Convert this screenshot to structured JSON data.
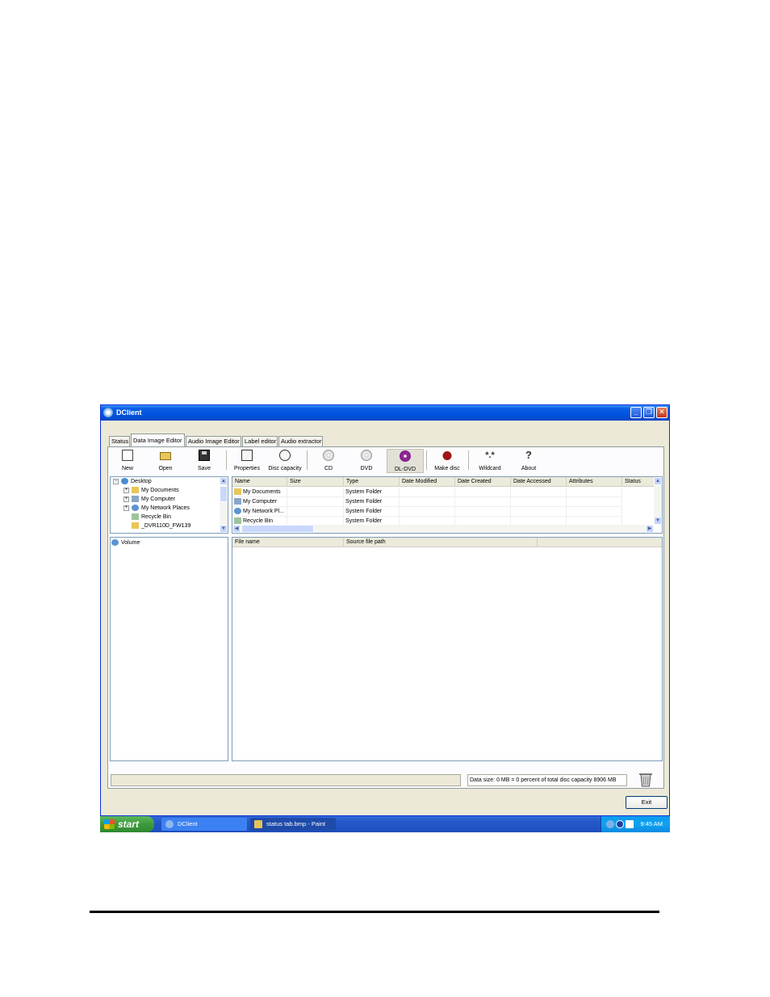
{
  "window": {
    "title": "DClient",
    "buttons": {
      "minimize": "_",
      "restore": "❐",
      "close": "✕"
    }
  },
  "tabs": [
    "Status",
    "Data Image Editor",
    "Audio Image Editor",
    "Label editor",
    "Audio extractor"
  ],
  "toolbar": {
    "new": "New",
    "open": "Open",
    "save": "Save",
    "properties": "Properties",
    "disc_capacity": "Disc capacity",
    "cd": "CD",
    "dvd": "DVD",
    "dl_dvd": "DL-DVD",
    "make_disc": "Make disc",
    "wildcard": "Wildcard",
    "wildcard_glyph": "*.*",
    "about": "About",
    "about_glyph": "?"
  },
  "tree": {
    "root": "Desktop",
    "items": [
      "My Documents",
      "My Computer",
      "My Network Places",
      "Recycle Bin",
      "_DVR110D_FW139"
    ]
  },
  "file_list": {
    "columns": [
      "Name",
      "Size",
      "Type",
      "Date Modified",
      "Date Created",
      "Date Accessed",
      "Attributes",
      "Status"
    ],
    "rows": [
      {
        "name": "My Documents",
        "size": "",
        "type": "System Folder"
      },
      {
        "name": "My Computer",
        "size": "",
        "type": "System Folder"
      },
      {
        "name": "My Network Pl...",
        "size": "",
        "type": "System Folder"
      },
      {
        "name": "Recycle Bin",
        "size": "",
        "type": "System Folder"
      }
    ]
  },
  "volume": {
    "label": "Volume"
  },
  "image_list": {
    "columns": [
      "File name",
      "Source file path",
      ""
    ]
  },
  "status": {
    "data_size": "Data size:  0 MB = 0 percent of total disc capacity 8906 MB"
  },
  "exit_label": "Exit",
  "taskbar": {
    "start": "start",
    "tasks": [
      "DClient",
      "status tab.bmp - Paint"
    ],
    "clock": "9:45 AM"
  },
  "colors": {
    "title_blue": "#0053e1",
    "xp_face": "#ece9d8",
    "dl_dvd": "#6a1a7a",
    "start_green": "#3c9a3c"
  }
}
